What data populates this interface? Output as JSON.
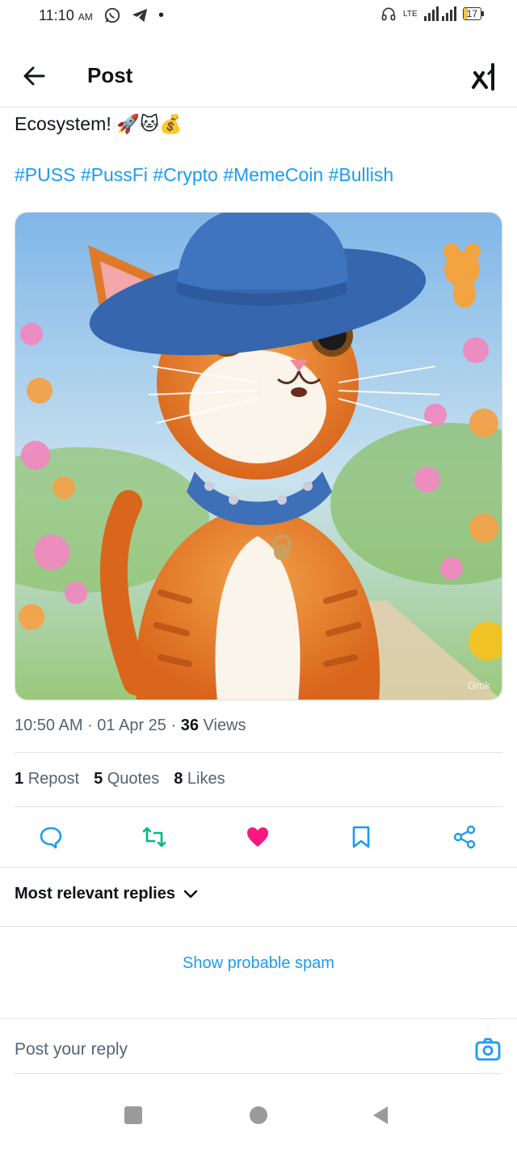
{
  "status_bar": {
    "time": "11:10",
    "ampm": "AM",
    "network": "LTE",
    "battery": "17"
  },
  "header": {
    "title": "Post",
    "back_icon": "arrow-left-icon",
    "grok_icon": "grok-icon"
  },
  "post": {
    "text": "Ecosystem! 🚀🐱💰",
    "hashtags": "#PUSS #PussFi #Crypto #MemeCoin #Bullish",
    "image_watermark": "Grok",
    "time": "10:50 AM",
    "date": "01 Apr 25",
    "views_count": "36",
    "views_label": "Views"
  },
  "stats": {
    "reposts_count": "1",
    "reposts_label": "Repost",
    "quotes_count": "5",
    "quotes_label": "Quotes",
    "likes_count": "8",
    "likes_label": "Likes"
  },
  "actions": {
    "reply_icon": "comment-icon",
    "repost_icon": "repost-icon",
    "like_icon": "heart-icon",
    "bookmark_icon": "bookmark-icon",
    "share_icon": "share-icon",
    "like_color": "#f91880",
    "repost_color": "#00ba7c"
  },
  "replies": {
    "filter_label": "Most relevant replies",
    "spam_link": "Show probable spam",
    "reply_placeholder": "Post your reply"
  },
  "colors": {
    "accent": "#1d9bf0",
    "text_primary": "#0f1419",
    "text_secondary": "#536471"
  }
}
